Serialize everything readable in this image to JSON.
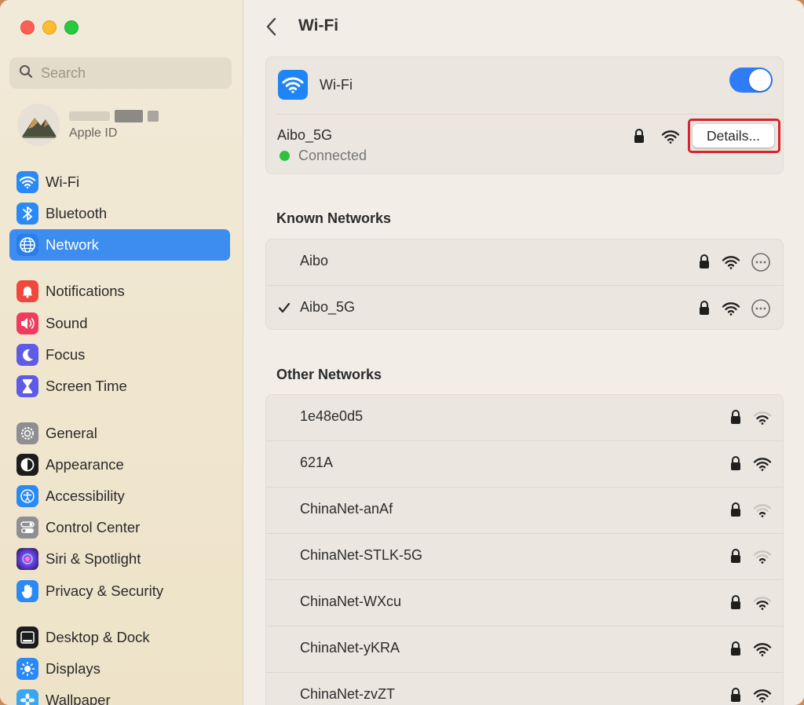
{
  "sidebar": {
    "search_placeholder": "Search",
    "profile_sub": "Apple ID",
    "items": [
      {
        "label": "Wi-Fi"
      },
      {
        "label": "Bluetooth"
      },
      {
        "label": "Network"
      },
      {
        "label": "Notifications"
      },
      {
        "label": "Sound"
      },
      {
        "label": "Focus"
      },
      {
        "label": "Screen Time"
      },
      {
        "label": "General"
      },
      {
        "label": "Appearance"
      },
      {
        "label": "Accessibility"
      },
      {
        "label": "Control Center"
      },
      {
        "label": "Siri & Spotlight"
      },
      {
        "label": "Privacy & Security"
      },
      {
        "label": "Desktop & Dock"
      },
      {
        "label": "Displays"
      },
      {
        "label": "Wallpaper"
      }
    ]
  },
  "header": {
    "title": "Wi-Fi"
  },
  "wifi": {
    "label": "Wi-Fi",
    "enabled": true,
    "current_network": "Aibo_5G",
    "status": "Connected",
    "details_label": "Details..."
  },
  "known": {
    "title": "Known Networks",
    "networks": [
      {
        "name": "Aibo",
        "checked": false
      },
      {
        "name": "Aibo_5G",
        "checked": true
      }
    ]
  },
  "other": {
    "title": "Other Networks",
    "networks": [
      {
        "name": "1e48e0d5",
        "signal": "strong"
      },
      {
        "name": "621A",
        "signal": "full"
      },
      {
        "name": "ChinaNet-anAf",
        "signal": "weak"
      },
      {
        "name": "ChinaNet-STLK-5G",
        "signal": "weak"
      },
      {
        "name": "ChinaNet-WXcu",
        "signal": "strong"
      },
      {
        "name": "ChinaNet-yKRA",
        "signal": "full"
      },
      {
        "name": "ChinaNet-zvZT",
        "signal": "full"
      }
    ]
  },
  "colors": {
    "accent": "#3d8cf0",
    "toggle_on": "#2f7cf6",
    "connected_green": "#2fc240",
    "highlight_red": "#d8242d"
  }
}
